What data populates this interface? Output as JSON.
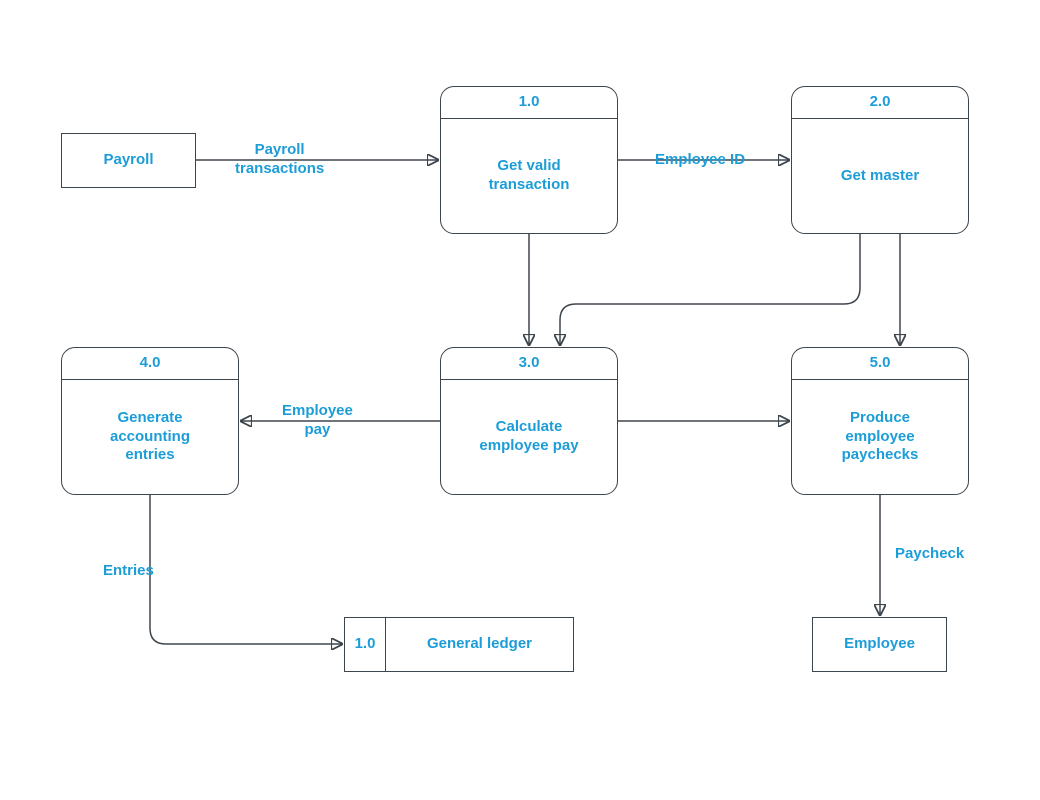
{
  "externals": {
    "payroll": {
      "label": "Payroll"
    },
    "employee": {
      "label": "Employee"
    }
  },
  "datastores": {
    "general_ledger": {
      "id": "1.0",
      "label": "General ledger"
    }
  },
  "processes": {
    "p1": {
      "id": "1.0",
      "label": "Get valid\ntransaction"
    },
    "p2": {
      "id": "2.0",
      "label": "Get master"
    },
    "p3": {
      "id": "3.0",
      "label": "Calculate\nemployee pay"
    },
    "p4": {
      "id": "4.0",
      "label": "Generate\naccounting\nentries"
    },
    "p5": {
      "id": "5.0",
      "label": "Produce\nemployee\npaychecks"
    }
  },
  "flows": {
    "payroll_to_p1": "Payroll\ntransactions",
    "p1_to_p2": "Employee ID",
    "p3_to_p4": "Employee\npay",
    "p4_to_gl": "Entries",
    "p5_to_emp": "Paycheck"
  }
}
